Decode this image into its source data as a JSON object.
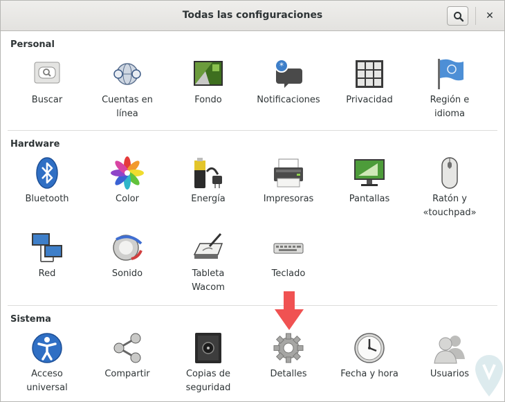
{
  "window": {
    "title": "Todas las configuraciones",
    "search_icon": "search-icon",
    "close_icon": "close-icon",
    "close_glyph": "✕"
  },
  "sections": {
    "personal": {
      "title": "Personal",
      "items": [
        {
          "label": "Buscar",
          "icon": "search-settings-icon"
        },
        {
          "label": "Cuentas en línea",
          "icon": "online-accounts-icon"
        },
        {
          "label": "Fondo",
          "icon": "background-icon"
        },
        {
          "label": "Notificaciones",
          "icon": "notifications-icon"
        },
        {
          "label": "Privacidad",
          "icon": "privacy-icon"
        },
        {
          "label": "Región e idioma",
          "icon": "region-flag-icon"
        }
      ]
    },
    "hardware": {
      "title": "Hardware",
      "items": [
        {
          "label": "Bluetooth",
          "icon": "bluetooth-icon"
        },
        {
          "label": "Color",
          "icon": "color-icon"
        },
        {
          "label": "Energía",
          "icon": "power-icon"
        },
        {
          "label": "Impresoras",
          "icon": "printer-icon"
        },
        {
          "label": "Pantallas",
          "icon": "displays-icon"
        },
        {
          "label": "Ratón y «touchpad»",
          "icon": "mouse-icon"
        },
        {
          "label": "Red",
          "icon": "network-icon"
        },
        {
          "label": "Sonido",
          "icon": "sound-icon"
        },
        {
          "label": "Tableta Wacom",
          "icon": "wacom-tablet-icon"
        },
        {
          "label": "Teclado",
          "icon": "keyboard-icon"
        }
      ]
    },
    "sistema": {
      "title": "Sistema",
      "items": [
        {
          "label": "Acceso universal",
          "icon": "universal-access-icon"
        },
        {
          "label": "Compartir",
          "icon": "share-icon"
        },
        {
          "label": "Copias de seguridad",
          "icon": "backup-safe-icon"
        },
        {
          "label": "Detalles",
          "icon": "details-gear-icon"
        },
        {
          "label": "Fecha y hora",
          "icon": "clock-icon"
        },
        {
          "label": "Usuarios",
          "icon": "users-icon"
        }
      ]
    }
  },
  "annotation": {
    "icon": "red-arrow-icon",
    "color": "#f05252"
  },
  "watermark": {
    "icon": "watermark-logo-icon"
  },
  "colors": {
    "text": "#2e3436",
    "titlebar": "#e8e7e4",
    "divider": "#dcdcda"
  }
}
